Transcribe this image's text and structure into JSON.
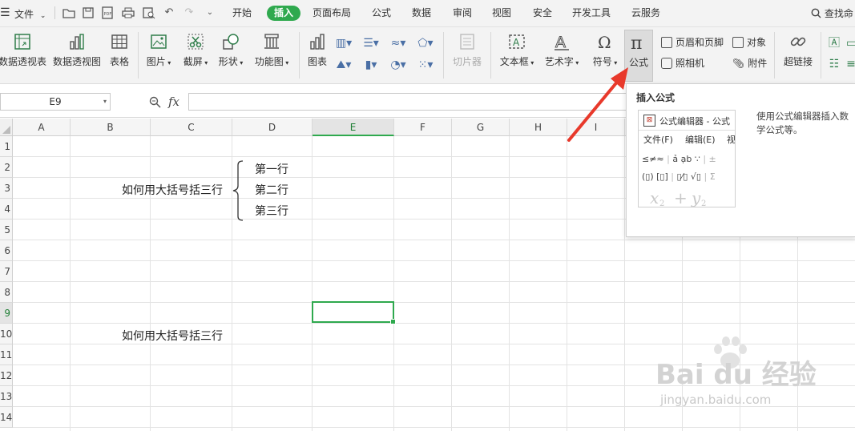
{
  "menubar": {
    "file_label": "文件",
    "tabs": [
      {
        "label": "开始",
        "active": false
      },
      {
        "label": "插入",
        "active": true
      },
      {
        "label": "页面布局",
        "active": false
      },
      {
        "label": "公式",
        "active": false
      },
      {
        "label": "数据",
        "active": false
      },
      {
        "label": "审阅",
        "active": false
      },
      {
        "label": "视图",
        "active": false
      },
      {
        "label": "安全",
        "active": false
      },
      {
        "label": "开发工具",
        "active": false
      },
      {
        "label": "云服务",
        "active": false
      }
    ],
    "search_label": "查找命"
  },
  "ribbon": {
    "pivot_table": "数据透视表",
    "pivot_chart": "数据透视图",
    "table": "表格",
    "picture": "图片",
    "screenshot": "截屏",
    "shape": "形状",
    "function_chart": "功能图",
    "chart": "图表",
    "slicer": "切片器",
    "textbox": "文本框",
    "wordart": "艺术字",
    "symbol": "符号",
    "formula": "公式",
    "header_footer": "页眉和页脚",
    "object": "对象",
    "camera": "照相机",
    "attachment": "附件",
    "hyperlink": "超链接"
  },
  "formula_bar": {
    "name_box": "E9",
    "fx_label": "fx",
    "value": ""
  },
  "sheet": {
    "columns": [
      "A",
      "B",
      "C",
      "D",
      "E",
      "F",
      "G",
      "H",
      "I"
    ],
    "selected_column": "E",
    "rows": [
      "1",
      "2",
      "3",
      "4",
      "5",
      "6",
      "7",
      "8",
      "9",
      "10",
      "11",
      "12",
      "13",
      "14"
    ],
    "selected_row": "9",
    "cells": {
      "c3": "如何用大括号括三行",
      "d2": "第一行",
      "d3": "第二行",
      "d4": "第三行",
      "c10": "如何用大括号括三行"
    }
  },
  "tooltip": {
    "title": "插入公式",
    "description": "使用公式编辑器插入数学公式等。",
    "preview_window_title": "公式编辑器 - 公式",
    "preview_menu_file": "文件(F)",
    "preview_menu_edit": "编辑(E)",
    "preview_menu_view": "视"
  },
  "watermark": {
    "brand": "Bai du 经验",
    "url": "jingyan.baidu.com"
  },
  "colors": {
    "accent": "#2fa94e",
    "arrow": "#e8392b",
    "formula_icon_bg": "#dcdcdc"
  }
}
